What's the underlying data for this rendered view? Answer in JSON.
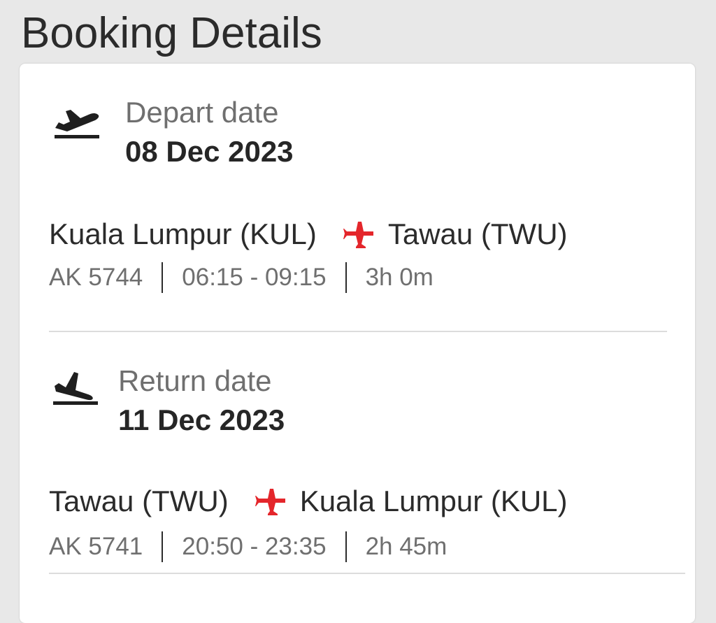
{
  "header": {
    "title": "Booking Details"
  },
  "depart": {
    "icon": "flight-takeoff-icon",
    "label": "Depart date",
    "date": "08 Dec 2023",
    "origin": "Kuala Lumpur (KUL)",
    "destination": "Tawau (TWU)",
    "flight_number": "AK 5744",
    "time_range": "06:15 - 09:15",
    "duration": "3h 0m"
  },
  "return": {
    "icon": "flight-landing-icon",
    "label": "Return date",
    "date": "11 Dec 2023",
    "origin": "Tawau (TWU)",
    "destination": "Kuala Lumpur (KUL)",
    "flight_number": "AK 5741",
    "time_range": "20:50 - 23:35",
    "duration": "2h 45m"
  },
  "colors": {
    "accent_red": "#e4262b",
    "page_background": "#e8e8e8",
    "card_background": "#ffffff"
  }
}
